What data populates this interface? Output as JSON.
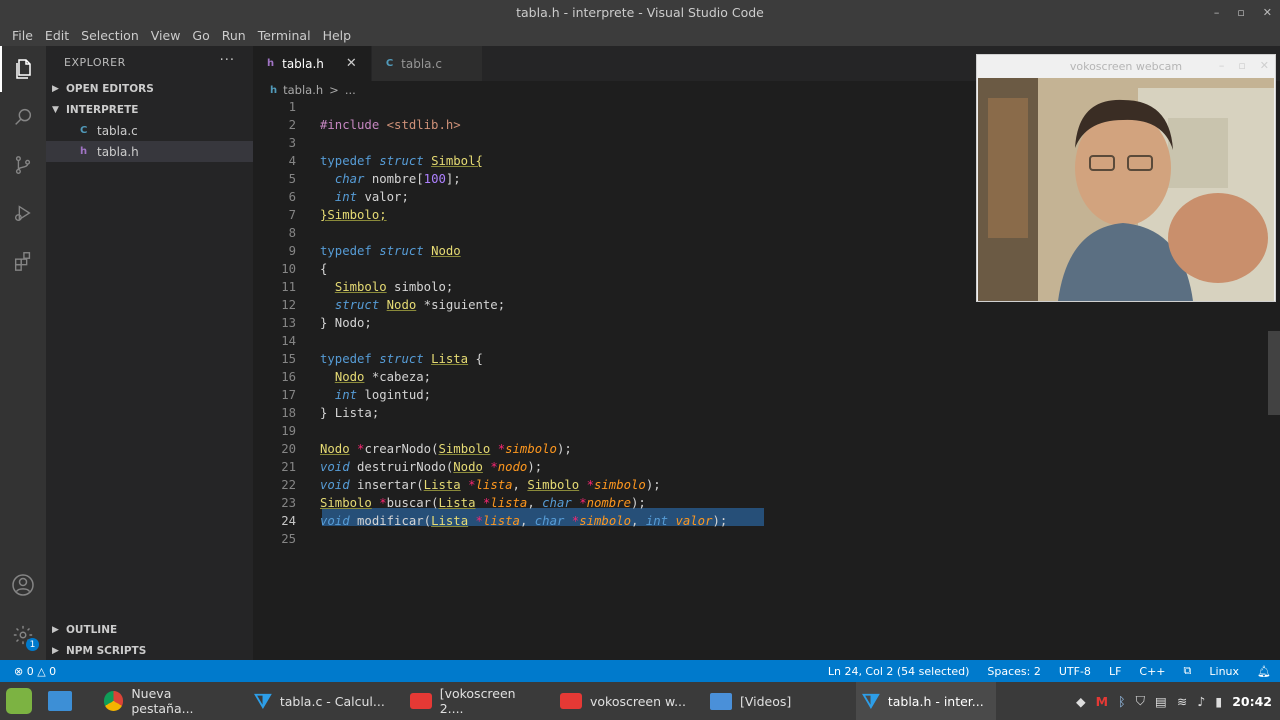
{
  "window": {
    "title": "tabla.h - interprete - Visual Studio Code",
    "minimize_glyph": "–",
    "maximize_glyph": "▫",
    "close_glyph": "✕"
  },
  "menu": [
    "File",
    "Edit",
    "Selection",
    "View",
    "Go",
    "Run",
    "Terminal",
    "Help"
  ],
  "activity": [
    "files-icon",
    "search-icon",
    "source-control-icon",
    "run-debug-icon",
    "extensions-icon",
    "account-icon",
    "manage-gear-icon"
  ],
  "manage_badge": "1",
  "sidebar": {
    "title": "EXPLORER",
    "more": "···",
    "open_editors": "OPEN EDITORS",
    "folder": "INTERPRETE",
    "files": [
      {
        "icon": "C",
        "name": "tabla.c"
      },
      {
        "icon": "h",
        "name": "tabla.h"
      }
    ],
    "outline": "OUTLINE",
    "npm": "NPM SCRIPTS"
  },
  "tabs": [
    {
      "icon": "h",
      "name": "tabla.h",
      "close": "✕"
    },
    {
      "icon": "C",
      "name": "tabla.c"
    }
  ],
  "breadcrumb": {
    "icon": "h",
    "file": "tabla.h",
    "sep": ">",
    "rest": "..."
  },
  "code_lines": [
    "1",
    "2",
    "3",
    "4",
    "5",
    "6",
    "7",
    "8",
    "9",
    "10",
    "11",
    "12",
    "13",
    "14",
    "15",
    "16",
    "17",
    "18",
    "19",
    "20",
    "21",
    "22",
    "23",
    "24",
    "25"
  ],
  "code": {
    "include": "#include",
    "header": "<stdlib.h>",
    "typedef": "typedef",
    "struct": "struct",
    "char": "char",
    "int": "int",
    "void": "void",
    "Simbol": "Simbol{",
    "nombre": "nombre[100];",
    "hundred": "100",
    "valor": "valor;",
    "simbolo_close": "}Simbolo;",
    "Nodo": "Nodo",
    "brace_open": "{",
    "Simbolo": "Simbolo",
    "simbolo_field": "simbolo;",
    "siguiente": "*siguiente;",
    "nodo_close": "} Nodo;",
    "Lista": "Lista",
    "cabeza": "*cabeza;",
    "logintud": "logintud;",
    "lista_close": "} Lista;",
    "crearNodo": "crearNodo",
    "destruirNodo": "destruirNodo",
    "insertar": "insertar",
    "buscar": "buscar",
    "modificar": "modificar"
  },
  "webcam": {
    "title": "vokoscreen webcam"
  },
  "status": {
    "errors": "⊗ 0 △ 0",
    "position": "Ln 24, Col 2 (54 selected)",
    "spaces": "Spaces: 2",
    "encoding": "UTF-8",
    "eol": "LF",
    "language": "C++",
    "os": "Linux"
  },
  "taskbar": {
    "items": [
      {
        "icon": "chrome-icon",
        "label": "Nueva pestaña..."
      },
      {
        "icon": "vscode-icon",
        "label": "tabla.c - Calcul..."
      },
      {
        "icon": "vokoscreen-icon",
        "label": "[vokoscreen 2...."
      },
      {
        "icon": "vokoscreen-icon",
        "label": "vokoscreen w..."
      },
      {
        "icon": "folder-icon",
        "label": "[Videos]"
      },
      {
        "icon": "vscode-icon",
        "label": "tabla.h - inter..."
      }
    ],
    "clock": "20:42"
  },
  "colors": {
    "accent": "#007acc",
    "selection": "#264f78",
    "keyword": "#569cd6",
    "type": "#e6db74",
    "param": "#fd971f",
    "pointer": "#f92672",
    "number": "#ae81ff"
  }
}
